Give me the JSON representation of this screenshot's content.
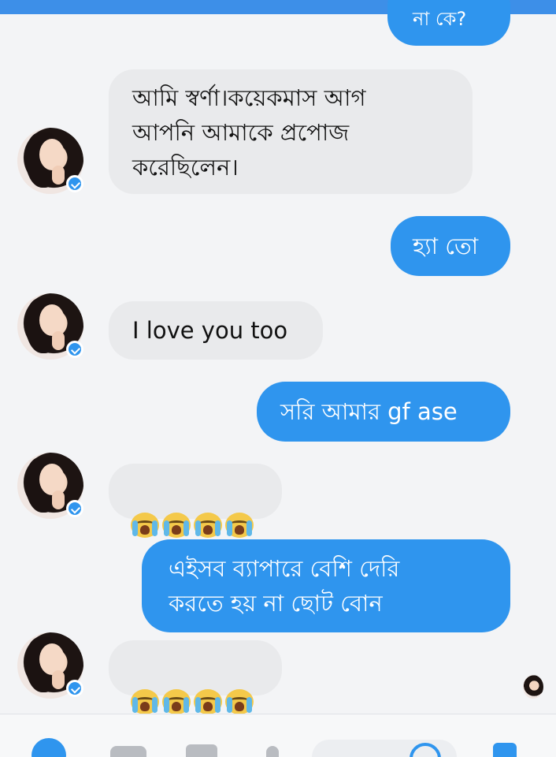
{
  "messages": {
    "top_partial": "না কে?",
    "m1": "আমি স্বর্ণা।কয়েকমাস আগ\nআপনি আমাকে প্রপোজ\nকরেছিলেন।",
    "m2": "হ্যা তো",
    "m3": "I love you too",
    "m4": "সরি আমার gf ase",
    "m5_emoji": "😭😭😭😭",
    "m6": "এইসব ব্যাপারে বেশি দেরি\nকরতে হয় না ছোট বোন",
    "m7_emoji": "😭😭😭😭"
  },
  "icons": {
    "avatar": "contact-avatar",
    "active": "messenger-badge-icon",
    "seen": "seen-avatar-icon",
    "composer": [
      "plus-icon",
      "camera-icon",
      "gallery-icon",
      "mic-icon",
      "emoji-icon",
      "like-icon"
    ]
  },
  "colors": {
    "outgoing": "#2f95ee",
    "incoming": "#e9eaec",
    "topbar": "#3d8fe8"
  }
}
